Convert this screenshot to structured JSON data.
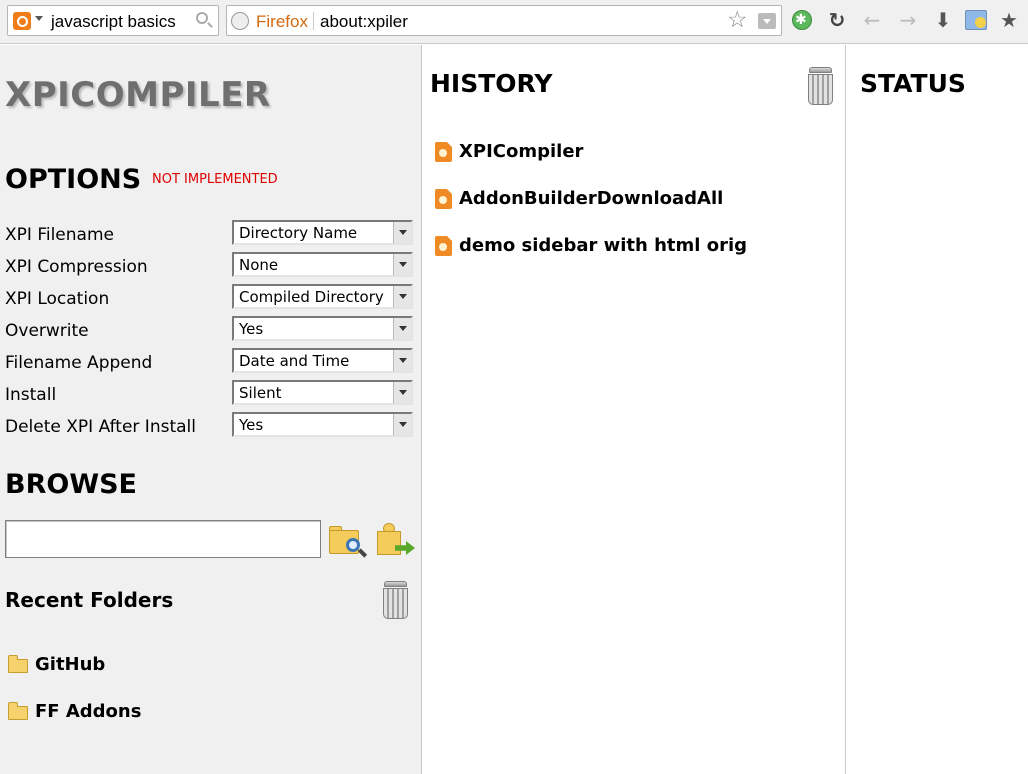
{
  "toolbar": {
    "search_text": "javascript basics",
    "identity_label": "Firefox",
    "url": "about:xpiler"
  },
  "app": {
    "title": "XPICOMPILER"
  },
  "options": {
    "heading": "OPTIONS",
    "badge": "NOT IMPLEMENTED",
    "rows": [
      {
        "label": "XPI Filename",
        "value": "Directory Name"
      },
      {
        "label": "XPI Compression",
        "value": "None"
      },
      {
        "label": "XPI Location",
        "value": "Compiled Directory"
      },
      {
        "label": "Overwrite",
        "value": "Yes"
      },
      {
        "label": "Filename Append",
        "value": "Date and Time"
      },
      {
        "label": "Install",
        "value": "Silent"
      },
      {
        "label": "Delete XPI After Install",
        "value": "Yes"
      }
    ]
  },
  "browse": {
    "heading": "BROWSE",
    "input_value": "",
    "recent_heading": "Recent Folders",
    "folders": [
      "GitHub",
      "FF Addons"
    ]
  },
  "history": {
    "heading": "HISTORY",
    "items": [
      "XPICompiler",
      "AddonBuilderDownloadAll",
      "demo sidebar with html orig"
    ]
  },
  "status": {
    "heading": "STATUS"
  },
  "colors": {
    "not_implemented": "#e00000",
    "identity": "#d46a12",
    "title": "#6f6f6f",
    "panel_bg": "#f0f0f0"
  },
  "icons": {
    "search_engine": "search-engine-icon",
    "identity": "site-identity-icon",
    "bookmark_star": "star-icon",
    "reload": "reload-icon",
    "back": "back-arrow-icon",
    "forward": "forward-arrow-icon",
    "downloads": "download-icon",
    "bookmarks": "bookmarks-icon",
    "trash": "trash-icon",
    "folder": "folder-icon",
    "file": "xpi-file-icon"
  }
}
